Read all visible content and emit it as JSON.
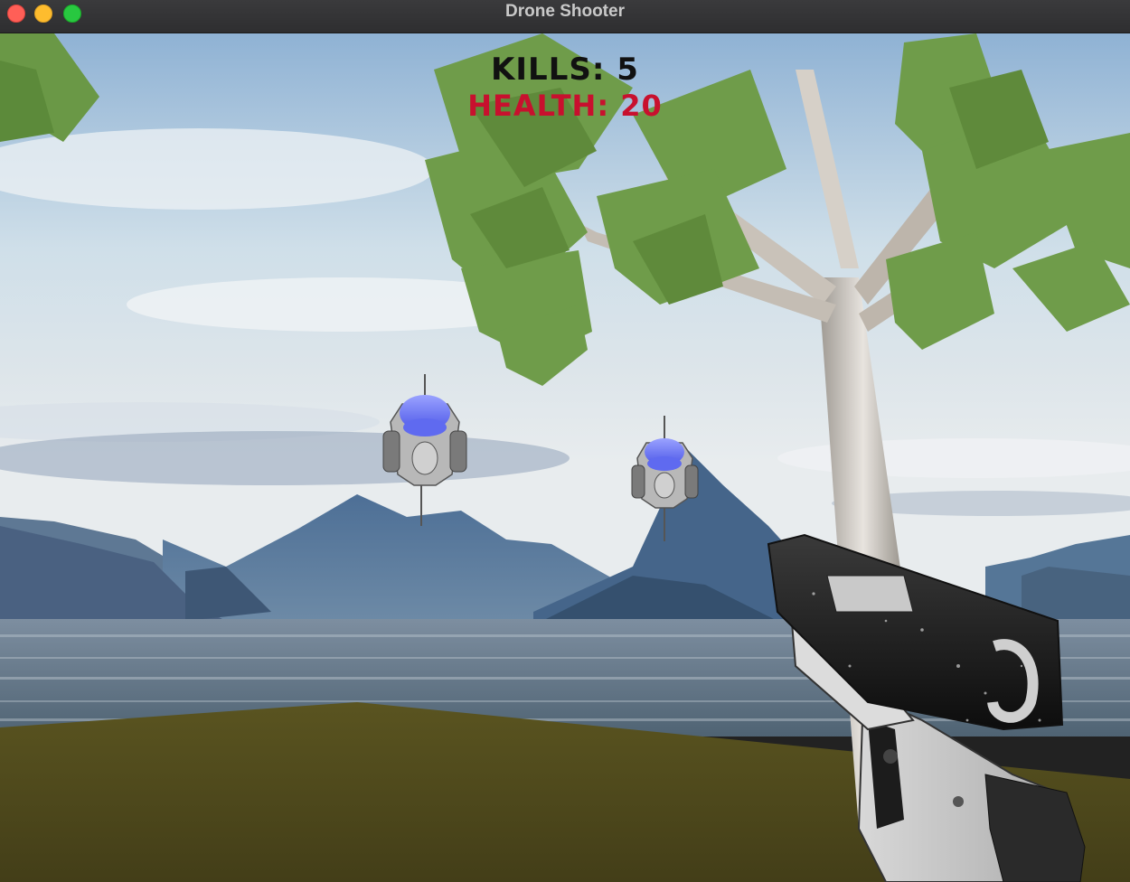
{
  "window": {
    "title": "Drone Shooter"
  },
  "hud": {
    "kills": "KILLS: 5",
    "health": "HEALTH: 20"
  },
  "colors": {
    "health": "#c8102e",
    "kills": "#111111",
    "ground": "#4f4a1c",
    "water": "#5d7080"
  },
  "scene": {
    "drone_count": 2,
    "weapon": "pistol-icon",
    "tree": "birch-tree",
    "environment": "mountain-lake"
  }
}
